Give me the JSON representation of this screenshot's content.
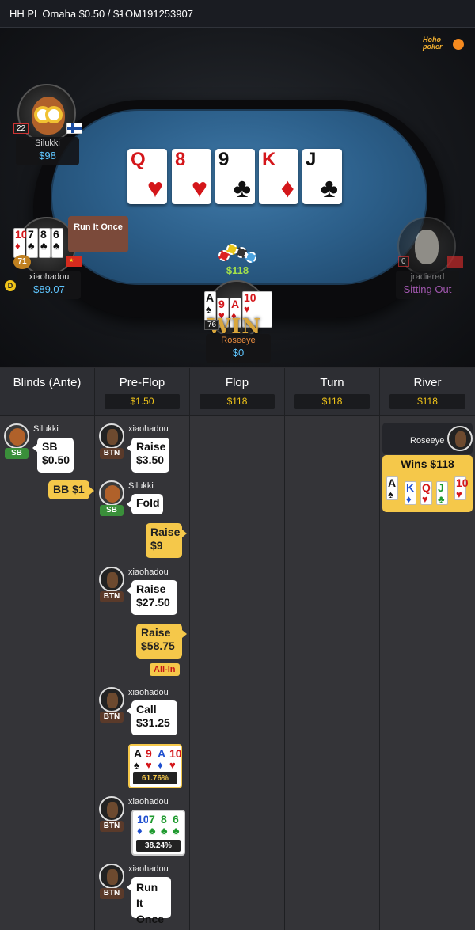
{
  "titlebar": {
    "game": "HH PL Omaha $0.50 / $1",
    "hand_id": "- OM191253907"
  },
  "logo": {
    "text1": "Hoho",
    "text2": "poker"
  },
  "board": [
    {
      "rank": "Q",
      "suit": "♥",
      "color": "red"
    },
    {
      "rank": "8",
      "suit": "♥",
      "color": "red"
    },
    {
      "rank": "9",
      "suit": "♣",
      "color": "blk"
    },
    {
      "rank": "K",
      "suit": "♦",
      "color": "red"
    },
    {
      "rank": "J",
      "suit": "♣",
      "color": "blk"
    }
  ],
  "seats": {
    "silukki": {
      "name": "Silukki",
      "stack": "$98",
      "level": "22",
      "flag": "finland"
    },
    "xiaohadou": {
      "name": "xiaohadou",
      "stack": "$89.07",
      "level": "71",
      "flag": "china",
      "hand": [
        {
          "rank": "10",
          "suit": "♦",
          "color": "red"
        },
        {
          "rank": "7",
          "suit": "♣",
          "color": "blk"
        },
        {
          "rank": "8",
          "suit": "♣",
          "color": "blk"
        },
        {
          "rank": "6",
          "suit": "♣",
          "color": "blk"
        }
      ]
    },
    "jradiered": {
      "name": "jradiered",
      "status": "Sitting Out",
      "level": "0"
    },
    "roseeye": {
      "name": "Roseeye",
      "stack": "$0",
      "level": "76",
      "win_label": "WIN",
      "hand": [
        {
          "rank": "A",
          "suit": "♠",
          "color": "blk"
        },
        {
          "rank": "9",
          "suit": "♥",
          "color": "red"
        },
        {
          "rank": "A",
          "suit": "♦",
          "color": "red"
        },
        {
          "rank": "10",
          "suit": "♥",
          "color": "red"
        }
      ]
    }
  },
  "table": {
    "pot": "$118",
    "run_it_popup": "Run It Once",
    "dealer_marker": "D"
  },
  "columns": [
    {
      "title": "Blinds (Ante)",
      "amount": ""
    },
    {
      "title": "Pre-Flop",
      "amount": "$1.50"
    },
    {
      "title": "Flop",
      "amount": "$118"
    },
    {
      "title": "Turn",
      "amount": "$118"
    },
    {
      "title": "River",
      "amount": "$118"
    }
  ],
  "actions": {
    "blinds_sb": {
      "player": "Silukki",
      "tag": "SB",
      "line1": "SB",
      "line2": "$0.50"
    },
    "blinds_bb": {
      "label": "BB  $1"
    },
    "pf1": {
      "player": "xiaohadou",
      "tag": "BTN",
      "line1": "Raise",
      "line2": "$3.50"
    },
    "pf2": {
      "player": "Silukki",
      "tag": "SB",
      "line1": "Fold"
    },
    "pf3": {
      "line1": "Raise",
      "line2": "$9"
    },
    "pf4": {
      "player": "xiaohadou",
      "tag": "BTN",
      "line1": "Raise",
      "line2": "$27.50"
    },
    "pf5": {
      "line1": "Raise",
      "line2": "$58.75",
      "allin": "All-In"
    },
    "pf6": {
      "player": "xiaohadou",
      "tag": "BTN",
      "line1": "Call",
      "line2": "$31.25"
    },
    "pf7": {
      "equity": "61.76%",
      "cards": [
        {
          "rank": "A",
          "suit": "♠",
          "color": "blk"
        },
        {
          "rank": "9",
          "suit": "♥",
          "color": "red"
        },
        {
          "rank": "A",
          "suit": "♦",
          "color": "red"
        },
        {
          "rank": "10",
          "suit": "♥",
          "color": "red"
        }
      ]
    },
    "pf8": {
      "player": "xiaohadou",
      "tag": "BTN",
      "equity": "38.24%",
      "cards": [
        {
          "rank": "10",
          "suit": "♦",
          "color": "blue"
        },
        {
          "rank": "7",
          "suit": "♣",
          "color": "green"
        },
        {
          "rank": "8",
          "suit": "♣",
          "color": "green"
        },
        {
          "rank": "6",
          "suit": "♣",
          "color": "green"
        }
      ]
    },
    "pf9": {
      "player": "xiaohadou",
      "tag": "BTN",
      "line1": "Run It",
      "line2": "Once"
    },
    "river": {
      "player": "Roseeye",
      "result": "Wins $118",
      "cards": [
        {
          "rank": "A",
          "suit": "♠",
          "color": "blk"
        },
        {
          "rank": "K",
          "suit": "♦",
          "color": "blue"
        },
        {
          "rank": "Q",
          "suit": "♥",
          "color": "red"
        },
        {
          "rank": "J",
          "suit": "♣",
          "color": "green"
        },
        {
          "rank": "10",
          "suit": "♥",
          "color": "red"
        }
      ]
    }
  }
}
